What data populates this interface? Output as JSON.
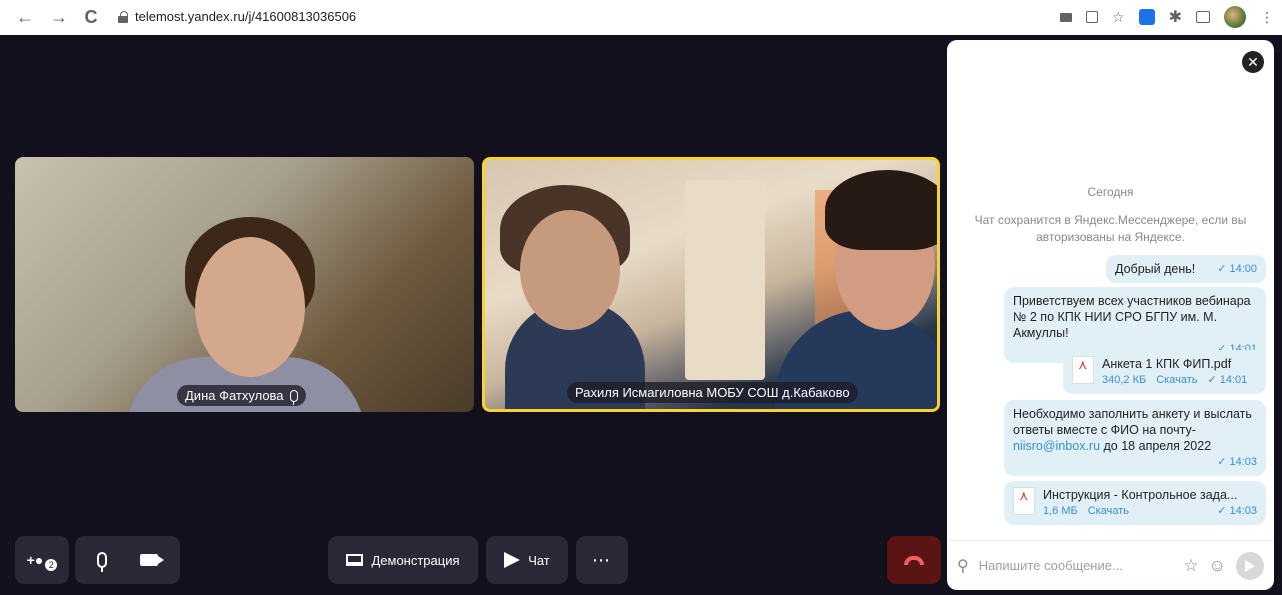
{
  "browser": {
    "back": "←",
    "forward": "→",
    "reload": "C",
    "url": "telemost.yandex.ru/j/41600813036506",
    "menu": "⋮"
  },
  "participants": [
    {
      "name": "Дина Фатхулова"
    },
    {
      "name": "Рахиля Исмагиловна МОБУ СОШ д.Кабаково"
    }
  ],
  "toolbar": {
    "demo_label": "Демонстрация",
    "chat_label": "Чат",
    "more_label": "⋯",
    "invite_badge": "2"
  },
  "chat": {
    "close": "✕",
    "day": "Сегодня",
    "notice": "Чат сохранится в Яндекс.Мессенджере, если вы авторизованы на Яндексе.",
    "messages": [
      {
        "text": "Добрый день!",
        "time": "✓ 14:00"
      },
      {
        "text": "Приветствуем всех участников вебинара № 2 по КПК НИИ СРО БГПУ им. М. Акмуллы!",
        "time": "✓ 14:01"
      },
      {
        "file": "Анкета 1 КПК ФИП.pdf",
        "size": "340,2 КБ",
        "download": "Скачать",
        "time": "✓ 14:01"
      },
      {
        "text_a": "Необходимо заполнить анкету и выслать  ответы вместе с ФИО на почту-",
        "email": "niisro@inbox.ru",
        "text_b": "до  18  апреля 2022",
        "time": "✓ 14:03"
      },
      {
        "file": "Инструкция - Контрольное зада...",
        "size": "1,6 МБ",
        "download": "Скачать",
        "time": "✓ 14:03"
      }
    ],
    "placeholder": "Напишите сообщение...",
    "star": "☆",
    "smile": "☺"
  }
}
